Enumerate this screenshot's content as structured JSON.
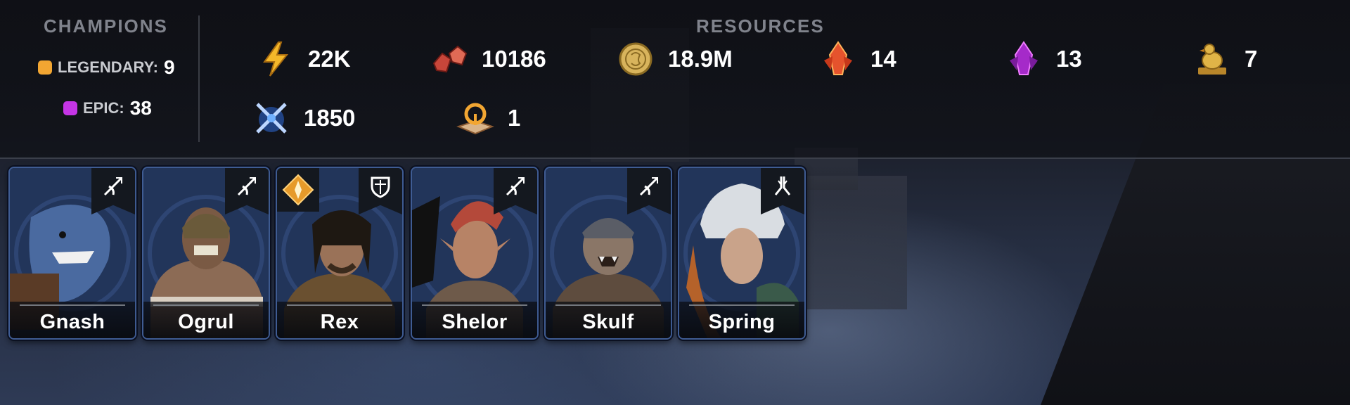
{
  "champions": {
    "title": "CHAMPIONS",
    "legendary": {
      "label": "LEGENDARY:",
      "count": "9",
      "color": "#f2a632"
    },
    "epic": {
      "label": "EPIC:",
      "count": "38",
      "color": "#c535e6"
    }
  },
  "resources": {
    "title": "RESOURCES",
    "items": [
      {
        "icon": "energy-icon",
        "value": "22K"
      },
      {
        "icon": "rubies-icon",
        "value": "10186"
      },
      {
        "icon": "silver-coin-icon",
        "value": "18.9M"
      },
      {
        "icon": "ancient-shard-icon",
        "value": "14"
      },
      {
        "icon": "void-shard-icon",
        "value": "13"
      },
      {
        "icon": "golden-chicken-icon",
        "value": "7"
      },
      {
        "icon": "arena-token-icon",
        "value": "1850"
      },
      {
        "icon": "skill-tome-icon",
        "value": "1"
      }
    ]
  },
  "cards": [
    {
      "name": "Gnash",
      "role": "attack-role-icon",
      "skin": "#4a6aa0"
    },
    {
      "name": "Ogrul",
      "role": "attack-role-icon",
      "skin": "#8c6b55"
    },
    {
      "name": "Rex",
      "role": "defense-role-icon",
      "affinity": "force-affinity-icon",
      "skin": "#9a7258"
    },
    {
      "name": "Shelor",
      "role": "attack-role-icon",
      "skin": "#b78366"
    },
    {
      "name": "Skulf",
      "role": "attack-role-icon",
      "skin": "#8a7667"
    },
    {
      "name": "Spring",
      "role": "support-role-icon",
      "skin": "#c9a38a"
    }
  ]
}
